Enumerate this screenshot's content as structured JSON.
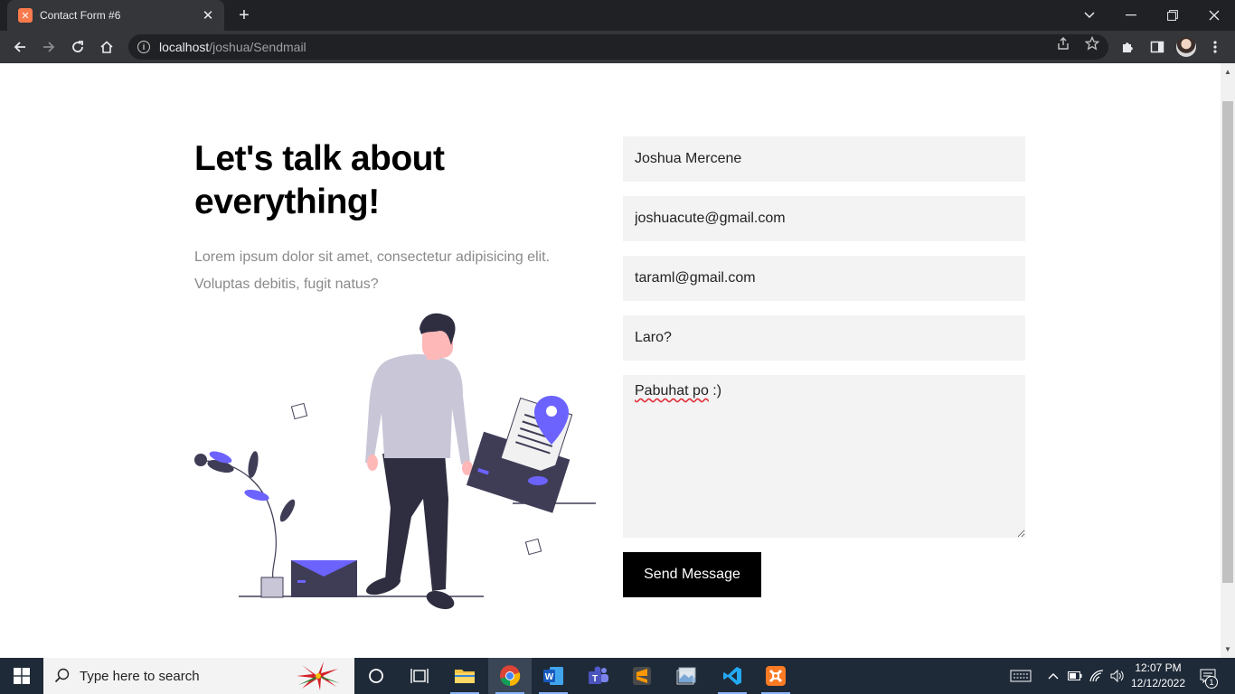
{
  "browser": {
    "tab_title": "Contact Form #6",
    "tab_icon": "xampp-icon",
    "url_host": "localhost",
    "url_path": "/joshua/Sendmail"
  },
  "page": {
    "heading": "Let's talk about everything!",
    "lead": "Lorem ipsum dolor sit amet, consectetur adipisicing elit. Voluptas debitis, fugit natus?",
    "form": {
      "name_value": "Joshua Mercene",
      "email_value": "joshuacute@gmail.com",
      "to_value": "taraml@gmail.com",
      "subject_value": "Laro?",
      "message_value": "Pabuhat po :)",
      "message_misspelled": "Pabuhat po",
      "message_rest": " :)",
      "send_label": "Send Message"
    }
  },
  "taskbar": {
    "search_placeholder": "Type here to search",
    "time": "12:07 PM",
    "date": "12/12/2022",
    "notification_count": "1"
  },
  "colors": {
    "accent": "#6c63ff",
    "dark": "#3f3d56",
    "button": "#000000",
    "field_bg": "#f3f3f3"
  }
}
